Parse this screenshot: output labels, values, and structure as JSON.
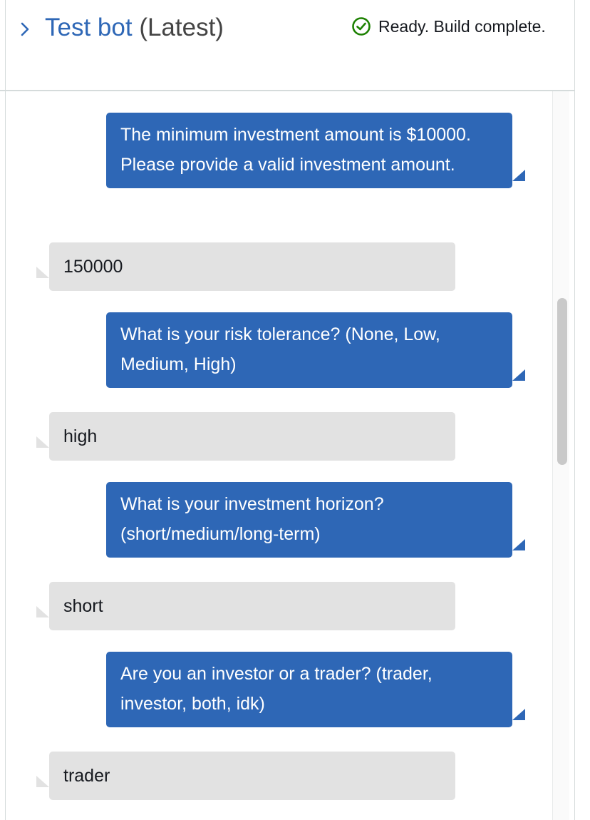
{
  "header": {
    "title_link": "Test bot",
    "title_version": "(Latest)",
    "status_text": "Ready. Build complete.",
    "status_icon": "check-circle-icon",
    "expand_icon": "chevron-right-icon"
  },
  "colors": {
    "accent": "#2e67b6",
    "bot_bubble": "#2e67b6",
    "user_bubble": "#e2e2e2",
    "success": "#1d8102"
  },
  "messages": [
    {
      "from": "bot",
      "text": "The minimum investment amount is $10000. Please provide a valid investment amount."
    },
    {
      "from": "user",
      "text": "150000"
    },
    {
      "from": "bot",
      "text": "What is your risk tolerance? (None, Low, Medium, High)"
    },
    {
      "from": "user",
      "text": "high"
    },
    {
      "from": "bot",
      "text": "What is your investment horizon? (short/medium/long-term)"
    },
    {
      "from": "user",
      "text": "short"
    },
    {
      "from": "bot",
      "text": "Are you an investor or a trader? (trader, investor, both, idk)"
    },
    {
      "from": "user",
      "text": "trader"
    }
  ]
}
